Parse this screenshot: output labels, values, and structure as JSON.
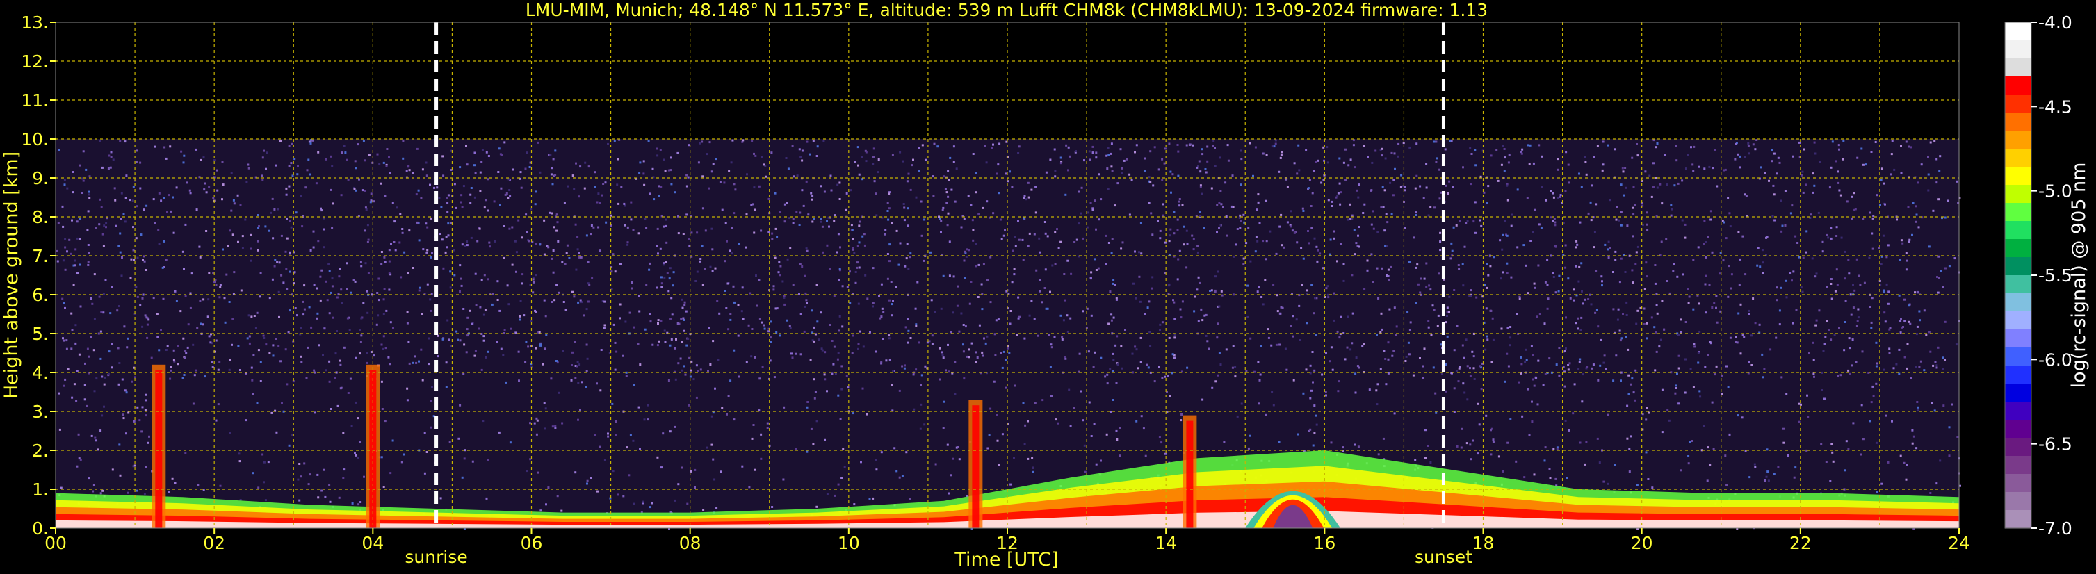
{
  "chart_data": {
    "type": "heatmap",
    "title": "LMU-MIM, Munich; 48.148° N 11.573° E, altitude: 539 m    Lufft CHM8k (CHM8kLMU): 13-09-2024    firmware: 1.13",
    "xlabel": "Time [UTC]",
    "ylabel": "Height above ground [km]",
    "xlim": [
      0,
      24
    ],
    "ylim": [
      0,
      13
    ],
    "x_ticks": [
      "00",
      "02",
      "04",
      "06",
      "08",
      "10",
      "12",
      "14",
      "16",
      "18",
      "20",
      "22",
      "24"
    ],
    "y_ticks": [
      "0.",
      "1.",
      "2.",
      "3.",
      "4.",
      "5.",
      "6.",
      "7.",
      "8.",
      "9.",
      "10.",
      "11.",
      "12.",
      "13."
    ],
    "grid": true,
    "signal_top_km": 10,
    "events": [
      {
        "label": "sunrise",
        "time": 4.8
      },
      {
        "label": "sunset",
        "time": 17.5
      }
    ],
    "colorbar": {
      "label": "log(rc-signal) @ 905 nm",
      "range": [
        -7.0,
        -4.0
      ],
      "ticks": [
        "-4.0",
        "-4.5",
        "-5.0",
        "-5.5",
        "-6.0",
        "-6.5",
        "-7.0"
      ],
      "colors": [
        "#ffffff",
        "#f2f2f2",
        "#dddddd",
        "#ff0000",
        "#ff3000",
        "#ff7000",
        "#ffa000",
        "#ffd000",
        "#ffff00",
        "#c0ff00",
        "#60ff40",
        "#20e060",
        "#00b040",
        "#009060",
        "#40c0a0",
        "#80c0e0",
        "#a0b0ff",
        "#8080ff",
        "#4060ff",
        "#2030ff",
        "#0000e0",
        "#4000c0",
        "#600090",
        "#6a1a80",
        "#7a3a8a",
        "#8a5a9a",
        "#9a78aa",
        "#aa90b8"
      ]
    },
    "layers": [
      {
        "name": "boundary-layer",
        "start": 0,
        "end": 24,
        "height_km": [
          0.9,
          0.8,
          0.6,
          0.5,
          0.4,
          0.4,
          0.5,
          0.7,
          1.3,
          1.8,
          2.0,
          1.5,
          1.0,
          0.9,
          0.9,
          0.8
        ]
      },
      {
        "name": "cloud-plume",
        "time": 1.3,
        "top_km": 4.2
      },
      {
        "name": "cloud-plume",
        "time": 4.0,
        "top_km": 4.2
      },
      {
        "name": "cloud-plume",
        "time": 11.6,
        "top_km": 3.3
      },
      {
        "name": "cloud-plume",
        "time": 14.3,
        "top_km": 2.9
      },
      {
        "name": "cloud-dome",
        "start": 15.0,
        "end": 16.2,
        "top_km": 1.9
      }
    ]
  }
}
